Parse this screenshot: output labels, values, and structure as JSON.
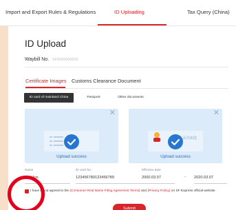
{
  "top_nav": {
    "tabs": [
      {
        "label": "Import and Export Rules & Regulations"
      },
      {
        "label": "ID Uploading"
      },
      {
        "label": "Tax Query (China)"
      }
    ],
    "active_index": 1
  },
  "page": {
    "title": "ID Upload",
    "waybill_label": "Waybill No.",
    "waybill_value": "SF0000000000"
  },
  "sub_tabs": [
    {
      "label": "Certificate Images"
    },
    {
      "label": "Customs Clearance Document"
    }
  ],
  "doc_types": [
    {
      "label": "ID card of mainland China"
    },
    {
      "label": "Passport"
    },
    {
      "label": "Other documents"
    }
  ],
  "uploads": {
    "left_status": "Upload success",
    "right_status": "Upload success",
    "close_glyph": "✕",
    "emblem_text": "中华人民共和国"
  },
  "fields": {
    "name_label": "Name",
    "name_value": "Zhi Hon",
    "id_label": "ID card No.",
    "id_value": "123456789123456789",
    "date_label": "Effective date",
    "date_start": "2000.03.07",
    "date_separator": "-",
    "date_end": "2020.03.07"
  },
  "agreement": {
    "part1": "I have",
    "part2": "d and agreed to the",
    "terms_link": "{Consumer Real Name Filing Agreement Terms}",
    "and": "and",
    "privacy_link": "{Privacy Policy}",
    "part3": "on SF Express official website"
  },
  "submit_label": "Submit",
  "colors": {
    "accent": "#d8242b",
    "background": "#f7dfc9",
    "upload_bg": "#dcebf9",
    "check_blue": "#2776d0",
    "highlight_ring": "#e3001b"
  },
  "icons": {
    "close": "close-icon",
    "check": "check-circle-icon",
    "checkbox": "checkbox-checked-icon"
  }
}
